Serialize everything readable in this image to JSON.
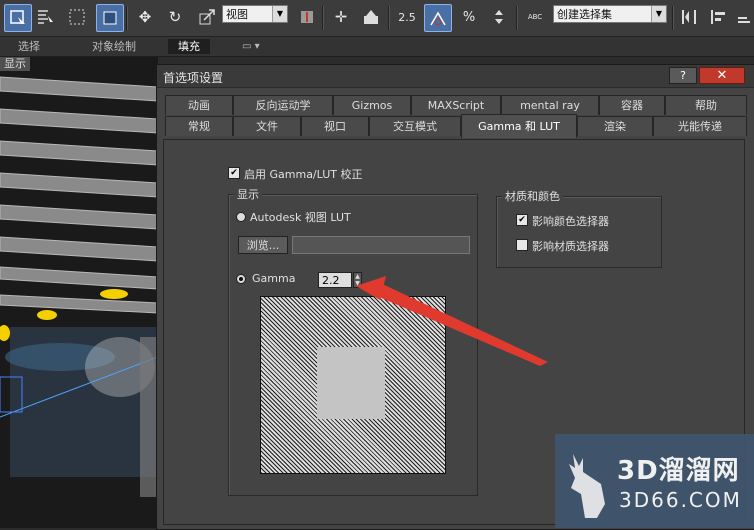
{
  "toolbar": {
    "view_combo": "视图",
    "spinner_snap": "2.5",
    "selection_set": "创建选择集",
    "percent_snap": "%",
    "abc": "ABC"
  },
  "ribbon": {
    "items": [
      "选择",
      "对象绘制",
      "填充"
    ]
  },
  "viewport": {
    "label": "显示"
  },
  "dialog": {
    "title": "首选项设置",
    "help": "?",
    "close": "✕",
    "tabs_row1": [
      "动画",
      "反向运动学",
      "Gizmos",
      "MAXScript",
      "mental ray",
      "容器",
      "帮助"
    ],
    "tabs_row2": [
      "常规",
      "文件",
      "视口",
      "交互模式",
      "Gamma 和 LUT",
      "渲染",
      "光能传递"
    ],
    "selected_tab": "Gamma 和 LUT",
    "enable_gamma_label": "启用 Gamma/LUT 校正",
    "enable_gamma_checked": true,
    "display_group": "显示",
    "autodesk_lut_label": "Autodesk 视图 LUT",
    "browse_label": "浏览...",
    "lut_path": "",
    "gamma_label": "Gamma",
    "gamma_value": "2.2",
    "materials_group": "材质和颜色",
    "affect_color_picker": "影响颜色选择器",
    "affect_color_picker_checked": true,
    "affect_material_picker": "影响材质选择器",
    "affect_material_picker_checked": false
  },
  "watermark": {
    "brand": "3D溜溜网",
    "url": "3D66.COM"
  },
  "colors": {
    "accent": "#4a6fa5",
    "arrow": "#e03a2e",
    "close": "#c0392b"
  }
}
